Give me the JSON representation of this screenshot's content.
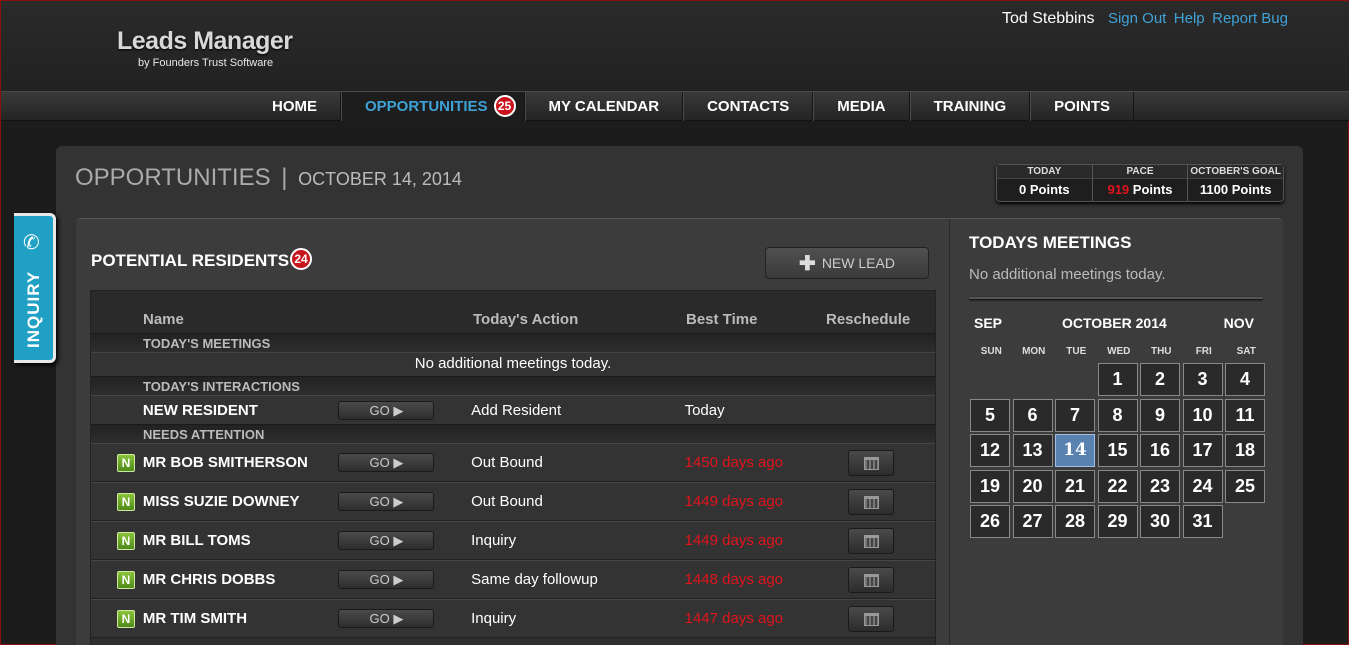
{
  "app": {
    "title": "Leads Manager",
    "subtitle": "by Founders Trust Software"
  },
  "user": {
    "name": "Tod Stebbins",
    "sign_out": "Sign Out",
    "help": "Help",
    "report_bug": "Report Bug"
  },
  "nav": {
    "items": [
      {
        "label": "HOME"
      },
      {
        "label": "OPPORTUNITIES",
        "badge": "25"
      },
      {
        "label": "MY CALENDAR"
      },
      {
        "label": "CONTACTS"
      },
      {
        "label": "MEDIA"
      },
      {
        "label": "TRAINING"
      },
      {
        "label": "POINTS"
      }
    ]
  },
  "inquiry_tab": {
    "label": "INQUIRY",
    "icon": "phone-icon"
  },
  "page": {
    "title": "OPPORTUNITIES",
    "separator": "|",
    "date": "OCTOBER 14, 2014"
  },
  "stats": [
    {
      "label": "TODAY",
      "value": "0",
      "unit": "Points"
    },
    {
      "label": "PACE",
      "value": "919",
      "unit": "Points",
      "value_color": "#e0141c"
    },
    {
      "label": "OCTOBER'S GOAL",
      "value": "1100",
      "unit": "Points"
    }
  ],
  "residents": {
    "title": "POTENTIAL RESIDENTS",
    "badge": "24",
    "new_lead_label": "NEW LEAD",
    "columns": {
      "name": "Name",
      "action": "Today's Action",
      "time": "Best Time",
      "reschedule": "Reschedule"
    },
    "sections": {
      "meetings": "TODAY'S MEETINGS",
      "meetings_empty": "No additional meetings today.",
      "interactions": "TODAY'S INTERACTIONS",
      "attention": "NEEDS ATTENTION"
    },
    "go_label": "GO ▶",
    "new_resident": {
      "name": "NEW RESIDENT",
      "action": "Add Resident",
      "time": "Today"
    },
    "rows": [
      {
        "flag": "N",
        "name": "MR BOB SMITHERSON",
        "action": "Out Bound",
        "time": "1450 days ago"
      },
      {
        "flag": "N",
        "name": "MISS SUZIE DOWNEY",
        "action": "Out Bound",
        "time": "1449 days ago"
      },
      {
        "flag": "N",
        "name": "MR BILL TOMS",
        "action": "Inquiry",
        "time": "1449 days ago"
      },
      {
        "flag": "N",
        "name": "MR CHRIS DOBBS",
        "action": "Same day followup",
        "time": "1448 days ago"
      },
      {
        "flag": "N",
        "name": "MR TIM SMITH",
        "action": "Inquiry",
        "time": "1447 days ago"
      }
    ]
  },
  "meetings": {
    "title": "TODAYS MEETINGS",
    "empty": "No additional meetings today.",
    "calendar": {
      "prev": "SEP",
      "month": "OCTOBER 2014",
      "next": "NOV",
      "dows": [
        "SUN",
        "MON",
        "TUE",
        "WED",
        "THU",
        "FRI",
        "SAT"
      ],
      "lead_blanks": 3,
      "days": [
        "1",
        "2",
        "3",
        "4",
        "5",
        "6",
        "7",
        "8",
        "9",
        "10",
        "11",
        "12",
        "13",
        "14",
        "15",
        "16",
        "17",
        "18",
        "19",
        "20",
        "21",
        "22",
        "23",
        "24",
        "25",
        "26",
        "27",
        "28",
        "29",
        "30",
        "31"
      ],
      "today": "14"
    }
  },
  "colors": {
    "accent": "#3fa2d6",
    "alert": "#e0141c",
    "badge": "#c8141c",
    "today_cell": "#5a82b0",
    "flag": "#6aa42a"
  }
}
